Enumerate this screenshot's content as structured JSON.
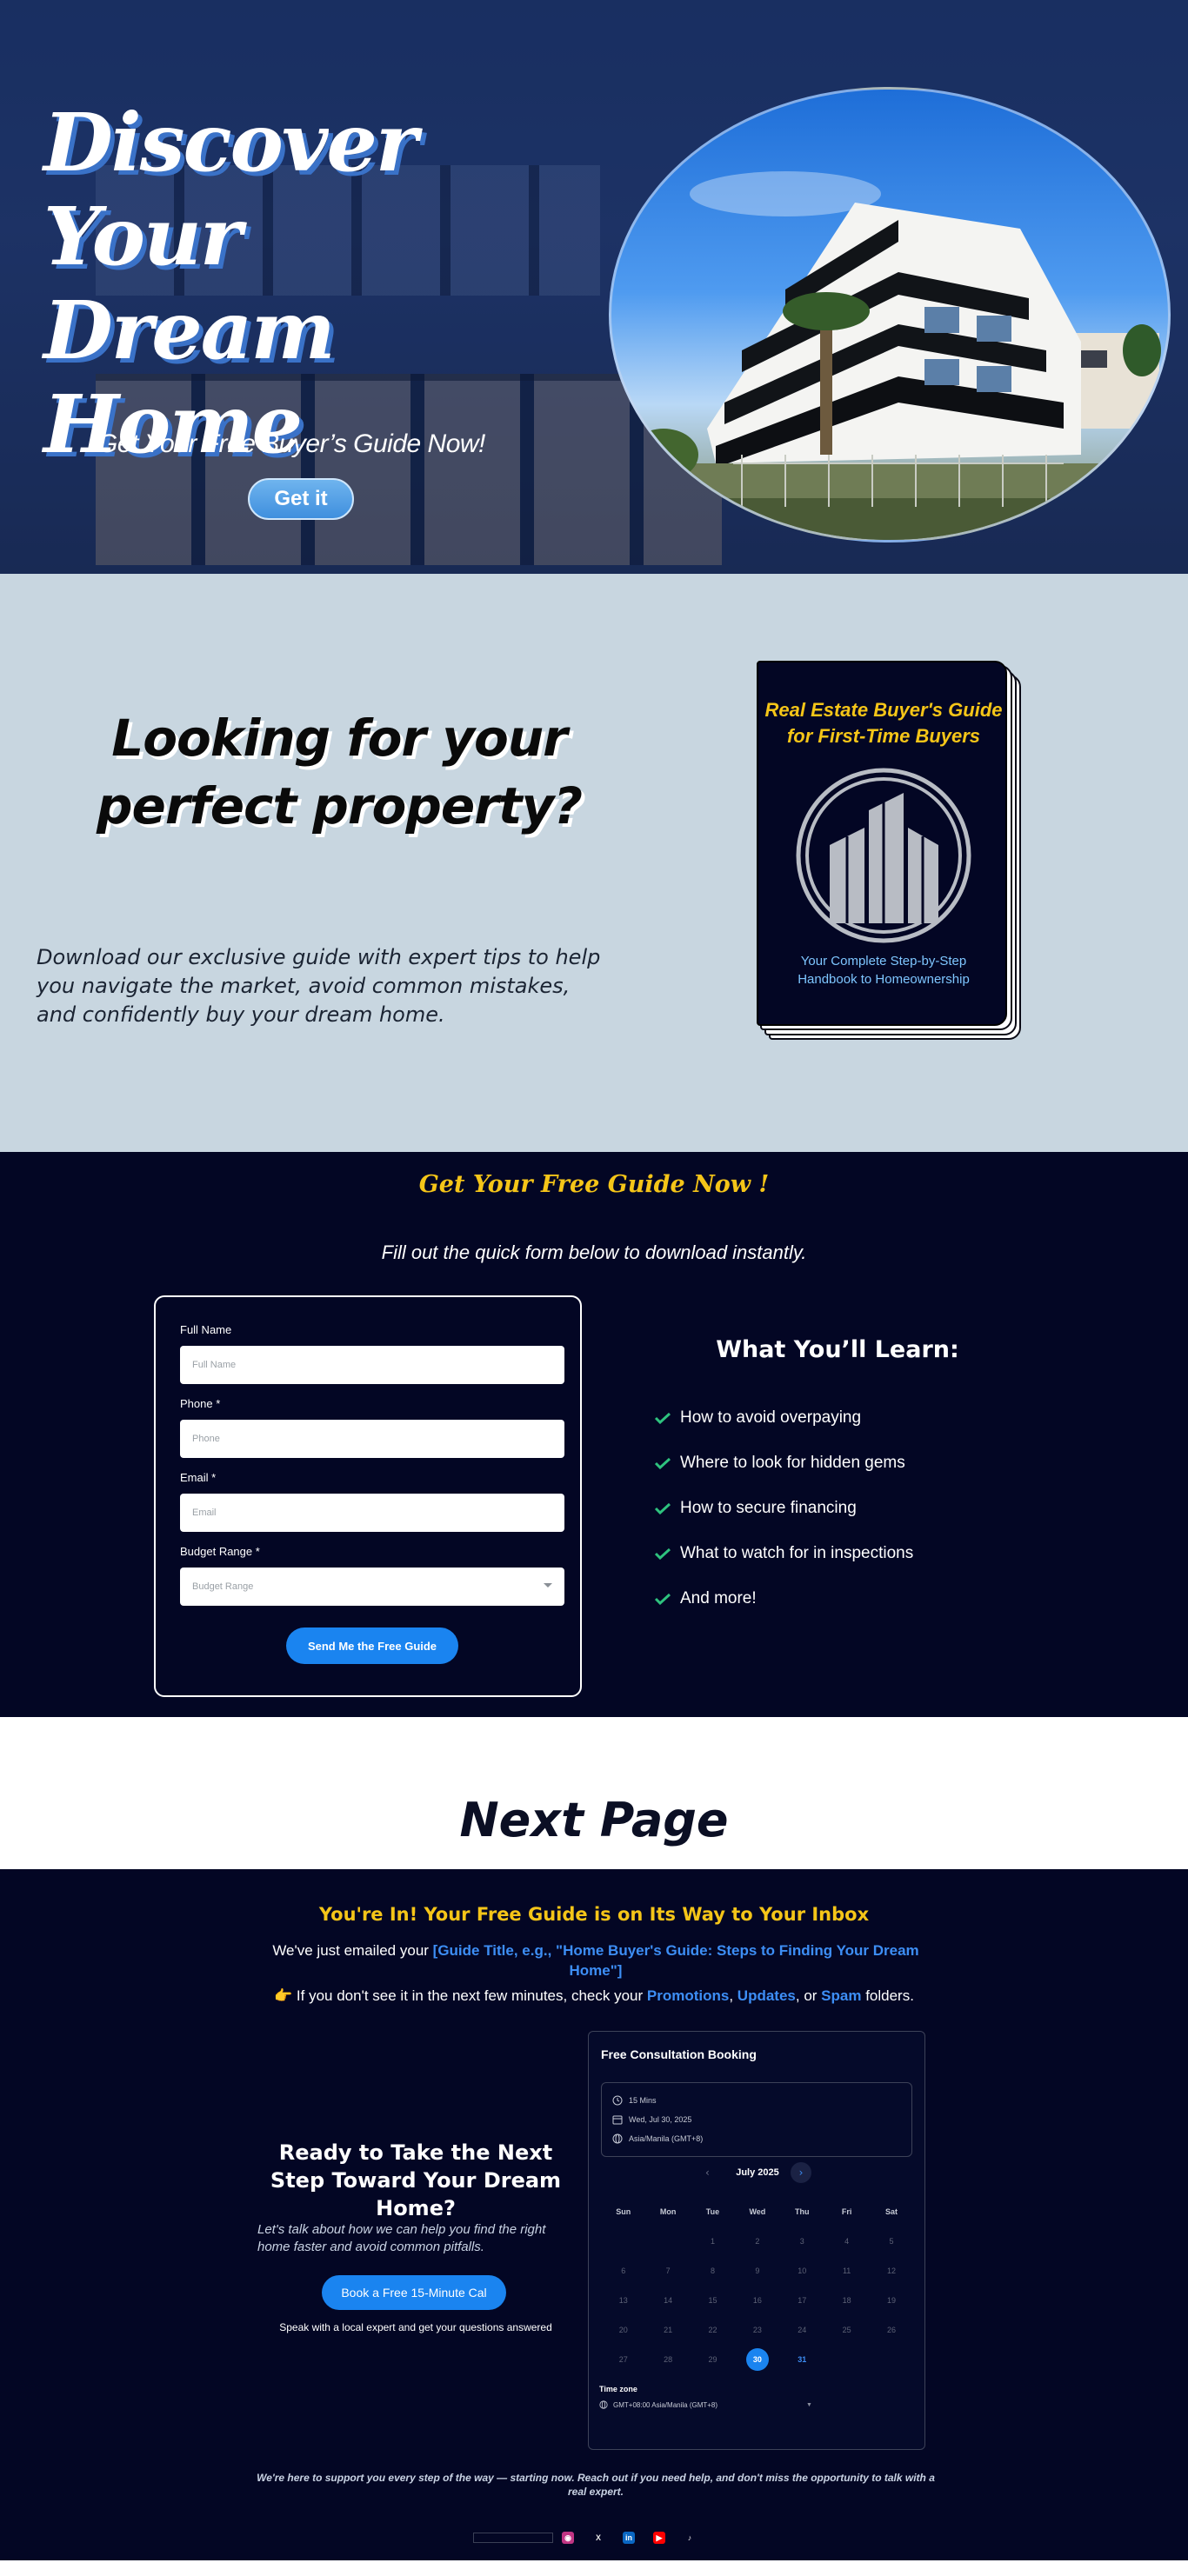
{
  "hero": {
    "title_line1": "Discover Your",
    "title_line2": "Dream Home",
    "subtitle": "Get Your Free Buyer’s Guide Now!",
    "cta_label": "Get it"
  },
  "intro": {
    "title_line1": "Looking for your",
    "title_line2": "perfect property?",
    "body": "Download our exclusive guide with expert tips to help you navigate the market, avoid common mistakes, and confidently buy your dream home.",
    "book": {
      "title_line1": "Real Estate Buyer's Guide",
      "title_line2": "for First-Time Buyers",
      "subtitle_line1": "Your Complete Step-by-Step",
      "subtitle_line2": "Handbook to Homeownership"
    }
  },
  "guide_form": {
    "title": "Get Your Free Guide Now !",
    "subtitle": "Fill out the quick form below to download instantly.",
    "fields": [
      {
        "label": "Full Name",
        "placeholder": "Full Name"
      },
      {
        "label": "Phone *",
        "placeholder": "Phone"
      },
      {
        "label": "Email *",
        "placeholder": "Email"
      },
      {
        "label": "Budget Range *",
        "placeholder": "Budget Range"
      }
    ],
    "submit_label": "Send Me the Free Guide"
  },
  "learn": {
    "title": "What You’ll Learn:",
    "items": [
      "How to avoid overpaying",
      "Where to look for hidden gems",
      "How to secure financing",
      "What to watch for in inspections",
      "And more!"
    ]
  },
  "next_page_label": "Next Page",
  "thank_you": {
    "title": "You're In! Your Free Guide is on Its Way to Your Inbox",
    "emailed_prefix": "We've just emailed your ",
    "emailed_highlight": "[Guide Title, e.g., \"Home Buyer's Guide: Steps to Finding Your Dream Home\"]",
    "check_emoji": "👉",
    "check_prefix": " If you don't see it in the next few minutes, check your ",
    "folder_promotions": "Promotions",
    "sep1": ", ",
    "folder_updates": "Updates",
    "sep2": ", or ",
    "folder_spam": "Spam",
    "check_suffix": " folders.",
    "next_step_title": "Ready to Take the Next Step Toward Your Dream Home?",
    "next_step_body": "Let's talk about how we can help you find the right home faster and avoid common pitfalls.",
    "cta_label": "Book a Free 15-Minute Cal",
    "cta_note": "Speak with a local expert and get your questions answered",
    "footer": "We're here to support you every step of the way — starting now. Reach out if you need help, and don't miss the opportunity to talk with a real expert."
  },
  "booking": {
    "title": "Free Consultation Booking",
    "duration": "15 Mins",
    "date": "Wed, Jul 30, 2025",
    "timezone_short": "Asia/Manila (GMT+8)",
    "month": "July 2025",
    "days_of_week": [
      "Sun",
      "Mon",
      "Tue",
      "Wed",
      "Thu",
      "Fri",
      "Sat"
    ],
    "weeks": [
      [
        "",
        "",
        "1",
        "2",
        "3",
        "4",
        "5"
      ],
      [
        "6",
        "7",
        "8",
        "9",
        "10",
        "11",
        "12"
      ],
      [
        "13",
        "14",
        "15",
        "16",
        "17",
        "18",
        "19"
      ],
      [
        "20",
        "21",
        "22",
        "23",
        "24",
        "25",
        "26"
      ],
      [
        "27",
        "28",
        "29",
        "30",
        "31",
        "",
        ""
      ]
    ],
    "selected_day": "30",
    "available_days": [
      "31"
    ],
    "timezone_label": "Time zone",
    "timezone_value": "GMT+08:00 Asia/Manila (GMT+8)"
  },
  "social_icons": [
    "instagram-icon",
    "x-icon",
    "linkedin-icon",
    "youtube-icon",
    "tiktok-icon"
  ],
  "colors": {
    "accent_yellow": "#f5c518",
    "navy": "#030624",
    "link_blue": "#3d8ef5",
    "button_blue": "#1a84f0",
    "check_green": "#2ec27e",
    "intro_bg": "#c8d6e0"
  }
}
